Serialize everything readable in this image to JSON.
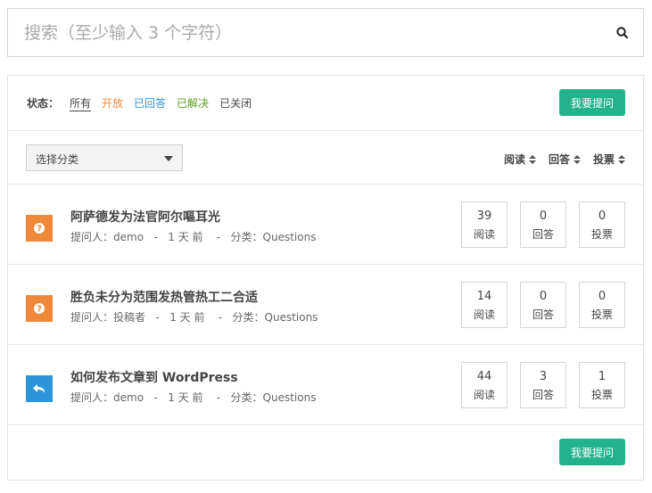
{
  "search": {
    "placeholder": "搜索（至少输入 3 个字符）"
  },
  "status": {
    "label": "状态：",
    "filters": [
      "所有",
      "开放",
      "已回答",
      "已解决",
      "已关闭"
    ]
  },
  "ask_label": "我要提问",
  "category_select": "选择分类",
  "sort": [
    "阅读",
    "回答",
    "投票"
  ],
  "questions": [
    {
      "icon": "question-icon",
      "icon_color": "#f0883a",
      "title": "阿萨德发为法官阿尔嘔耳光",
      "meta": "提问人：demo   -   1 天 前    -   分类：Questions",
      "views": "39",
      "views_label": "阅读",
      "answers": "0",
      "answers_label": "回答",
      "votes": "0",
      "votes_label": "投票"
    },
    {
      "icon": "question-icon",
      "icon_color": "#f0883a",
      "title": "胜负未分为范围发热管热工二合适",
      "meta": "提问人：投稿者   -   1 天 前    -   分类：Questions",
      "views": "14",
      "views_label": "阅读",
      "answers": "0",
      "answers_label": "回答",
      "votes": "0",
      "votes_label": "投票"
    },
    {
      "icon": "reply-icon",
      "icon_color": "#2a95d9",
      "title": "如何发布文章到 WordPress",
      "meta": "提问人：demo   -   1 天 前    -   分类：Questions",
      "views": "44",
      "views_label": "阅读",
      "answers": "3",
      "answers_label": "回答",
      "votes": "1",
      "votes_label": "投票"
    }
  ],
  "colors": {
    "accent": "#23b38c",
    "open": "#f0883a",
    "answered": "#2a95d9",
    "solved": "#5c9b1f"
  }
}
